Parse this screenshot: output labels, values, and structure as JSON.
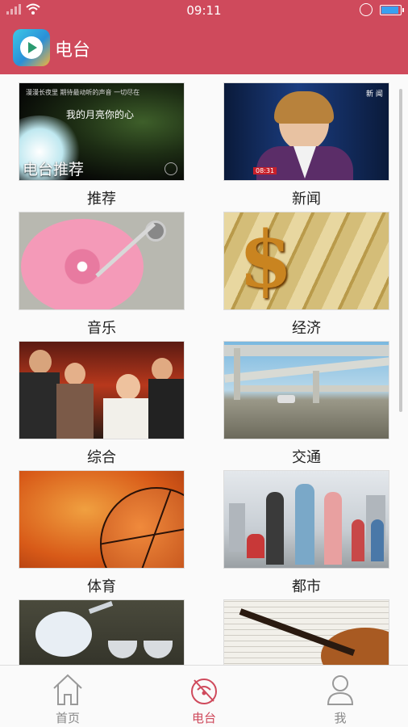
{
  "status": {
    "time": "09:11",
    "battery_level": 0.85
  },
  "header": {
    "title": "电台"
  },
  "categories": [
    {
      "label": "推荐",
      "overlay_title": "电台推荐",
      "caption_line1": "漫漫长夜里 期待最动听的声音 一切尽在",
      "caption_line2": "我的月亮你的心"
    },
    {
      "label": "新闻",
      "corner_tag": "新 闻",
      "ticker": "08:31"
    },
    {
      "label": "音乐"
    },
    {
      "label": "经济"
    },
    {
      "label": "综合"
    },
    {
      "label": "交通"
    },
    {
      "label": "体育"
    },
    {
      "label": "都市"
    },
    {
      "label": ""
    },
    {
      "label": ""
    }
  ],
  "tabs": [
    {
      "label": "首页",
      "icon": "home-icon"
    },
    {
      "label": "电台",
      "icon": "radio-icon"
    },
    {
      "label": "我",
      "icon": "profile-icon"
    }
  ],
  "colors": {
    "brand": "#cf4a5c",
    "active_tab": "#cf4a5c",
    "inactive_tab": "#888888"
  }
}
